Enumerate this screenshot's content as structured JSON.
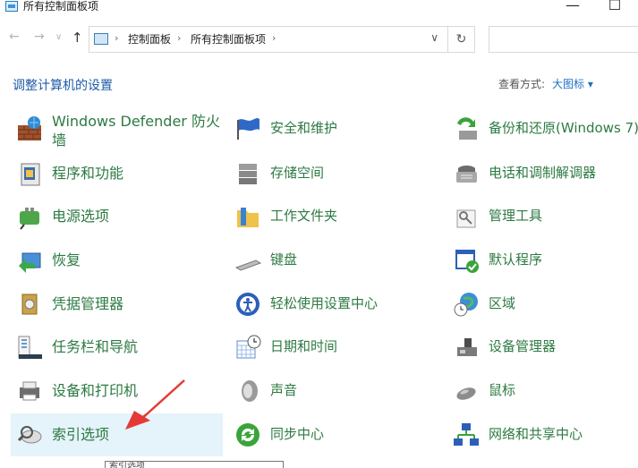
{
  "window": {
    "title": "所有控制面板项",
    "minimize_glyph": "—",
    "maximize_glyph": "☐"
  },
  "nav": {
    "back_glyph": "←",
    "forward_glyph": "→",
    "recent_glyph": "∨",
    "up_glyph": "↑",
    "breadcrumb": [
      "控制面板",
      "所有控制面板项"
    ],
    "separator": "›",
    "dropdown_glyph": "∨",
    "refresh_glyph": "↻",
    "search_placeholder": ""
  },
  "header": {
    "heading": "调整计算机的设置",
    "view_by_label": "查看方式:",
    "view_by_value": "大图标 ▾"
  },
  "items": [
    {
      "label": "Windows Defender 防火",
      "label2": "墙",
      "icon": "firewall-icon"
    },
    {
      "label": "安全和维护",
      "icon": "security-flag-icon"
    },
    {
      "label": "备份和还原(Windows 7)",
      "icon": "backup-restore-icon"
    },
    {
      "label": "程序和功能",
      "icon": "programs-icon"
    },
    {
      "label": "存储空间",
      "icon": "storage-icon"
    },
    {
      "label": "电话和调制解调器",
      "icon": "phone-modem-icon"
    },
    {
      "label": "电源选项",
      "icon": "power-icon"
    },
    {
      "label": "工作文件夹",
      "icon": "work-folders-icon"
    },
    {
      "label": "管理工具",
      "icon": "admin-tools-icon"
    },
    {
      "label": "恢复",
      "icon": "recovery-icon"
    },
    {
      "label": "键盘",
      "icon": "keyboard-icon"
    },
    {
      "label": "默认程序",
      "icon": "default-programs-icon"
    },
    {
      "label": "凭据管理器",
      "icon": "credential-manager-icon"
    },
    {
      "label": "轻松使用设置中心",
      "icon": "ease-of-access-icon"
    },
    {
      "label": "区域",
      "icon": "region-icon"
    },
    {
      "label": "任务栏和导航",
      "icon": "taskbar-icon"
    },
    {
      "label": "日期和时间",
      "icon": "date-time-icon"
    },
    {
      "label": "设备管理器",
      "icon": "device-manager-icon"
    },
    {
      "label": "设备和打印机",
      "icon": "printer-icon"
    },
    {
      "label": "声音",
      "icon": "sound-icon"
    },
    {
      "label": "鼠标",
      "icon": "mouse-icon"
    },
    {
      "label": "索引选项",
      "icon": "indexing-icon"
    },
    {
      "label": "同步中心",
      "icon": "sync-icon"
    },
    {
      "label": "网络和共享中心",
      "icon": "network-icon"
    }
  ],
  "tooltip": "索引选项",
  "colors": {
    "item_text": "#2d7a43",
    "heading": "#1e5aa8",
    "link": "#1e6fc6",
    "hover_bg": "#e5f3fb",
    "arrow": "#e53935"
  }
}
